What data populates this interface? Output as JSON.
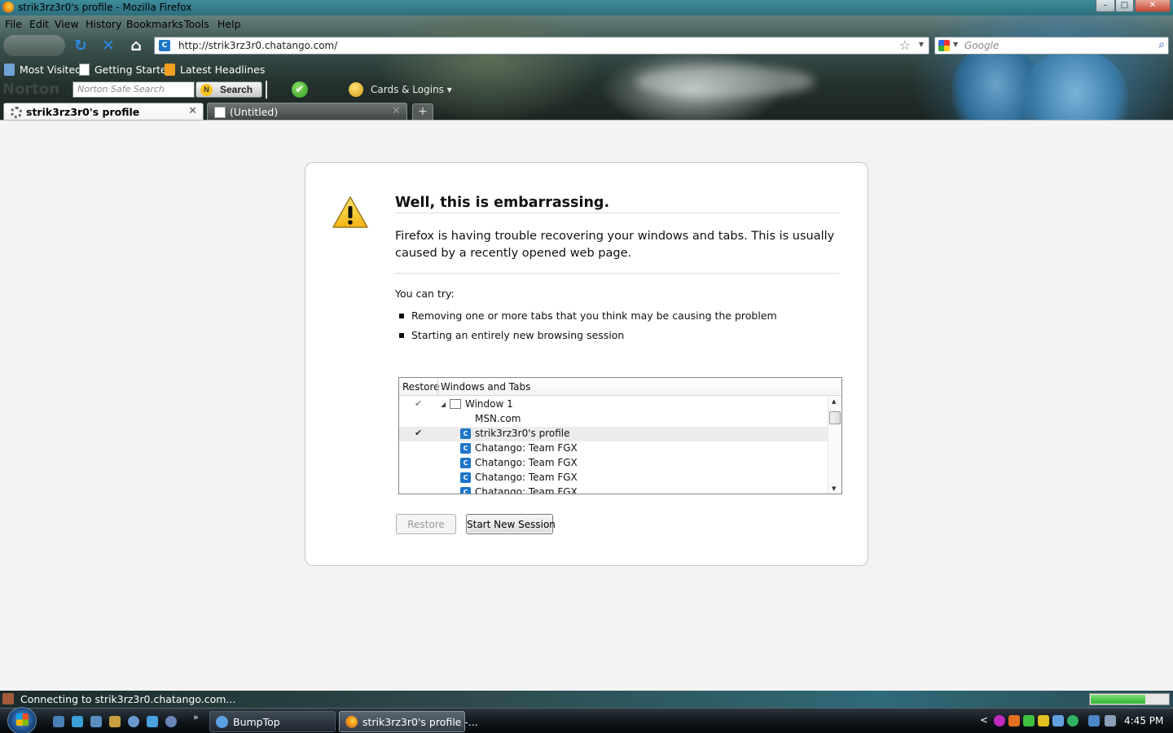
{
  "window": {
    "title": "strik3rz3r0's profile - Mozilla Firefox",
    "controls": {
      "minimize": "–",
      "maximize": "□",
      "close": "✕"
    }
  },
  "menu": [
    "File",
    "Edit",
    "View",
    "History",
    "Bookmarks",
    "Tools",
    "Help"
  ],
  "nav": {
    "url": "http://strik3rz3r0.chatango.com/",
    "url_favicon": "C",
    "search_engine": "Google",
    "reload_icon": "↻",
    "stop_icon": "✕",
    "home_icon": "⌂"
  },
  "bookmarks": [
    "Most Visited",
    "Getting Started",
    "Latest Headlines"
  ],
  "norton": {
    "placeholder": "Norton Safe Search",
    "search_button": "Search",
    "logo_letter": "N",
    "check": "✔",
    "cards_label": "Cards & Logins ▾",
    "watermark": "Norton"
  },
  "tabs": [
    {
      "label": "strik3rz3r0's profile",
      "active": true
    },
    {
      "label": "(Untitled)",
      "active": false
    }
  ],
  "tab_close": "✕",
  "new_tab": "+",
  "error": {
    "title": "Well, this is embarrassing.",
    "message": "Firefox is having trouble recovering your windows and tabs. This is usually caused by a recently opened web page.",
    "try_label": "You can try:",
    "suggestions": [
      "Removing one or more tabs that you think may be causing the problem",
      "Starting an entirely new browsing session"
    ]
  },
  "tree": {
    "columns": [
      "Restore",
      "Windows and Tabs"
    ],
    "rows": [
      {
        "label": "Window 1",
        "checked": true,
        "type": "window",
        "twisty": "◢"
      },
      {
        "label": "MSN.com",
        "checked": false,
        "type": "tab-noicon"
      },
      {
        "label": "strik3rz3r0's profile",
        "checked": true,
        "type": "tab",
        "selected": true
      },
      {
        "label": "Chatango: Team FGX",
        "checked": false,
        "type": "tab"
      },
      {
        "label": "Chatango: Team FGX",
        "checked": false,
        "type": "tab"
      },
      {
        "label": "Chatango: Team FGX",
        "checked": false,
        "type": "tab"
      },
      {
        "label": "Chatango: Team FGX",
        "checked": false,
        "type": "tab"
      }
    ],
    "check_glyph": "✔",
    "tab_icon_letter": "C"
  },
  "buttons": {
    "restore": "Restore",
    "new_session": "Start New Session"
  },
  "status": {
    "text": "Connecting to strik3rz3r0.chatango.com...",
    "progress": 0.7
  },
  "taskbar": {
    "tasks": [
      "BumpTop",
      "strik3rz3r0's profile -..."
    ],
    "more": "»",
    "tray_chevron": "<",
    "clock": "4:45 PM"
  },
  "colors": {
    "accent": "#1d76c8",
    "title_bar": "#2d6f7c"
  }
}
